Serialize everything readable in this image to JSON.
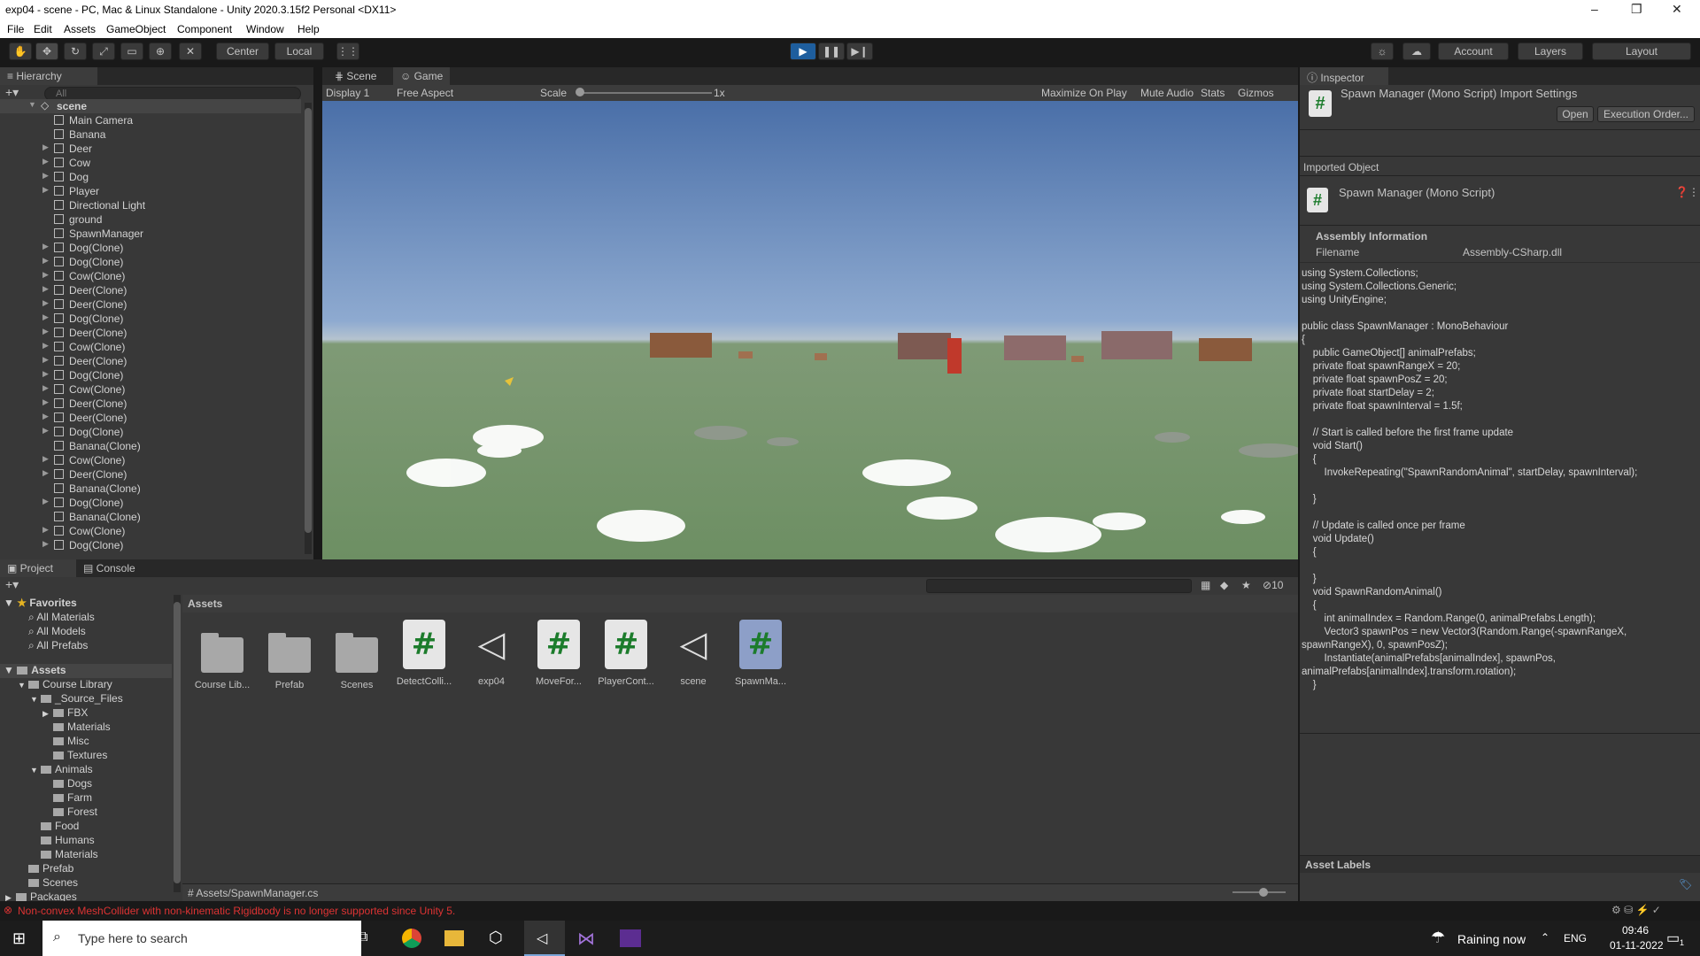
{
  "window": {
    "title": "exp04 - scene - PC, Mac & Linux Standalone - Unity 2020.3.15f2 Personal <DX11>",
    "minimize": "–",
    "maximize": "❐",
    "close": "✕"
  },
  "menu": [
    "File",
    "Edit",
    "Assets",
    "GameObject",
    "Component",
    "Window",
    "Help"
  ],
  "toolbar": {
    "center": "Center",
    "local": "Local",
    "account": "Account",
    "layers": "Layers",
    "layout": "Layout"
  },
  "hierarchy": {
    "tab": "Hierarchy",
    "search_placeholder": "All",
    "scene": "scene",
    "items": [
      {
        "label": "Main Camera",
        "arrow": ""
      },
      {
        "label": "Banana",
        "arrow": ""
      },
      {
        "label": "Deer",
        "arrow": "▶"
      },
      {
        "label": "Cow",
        "arrow": "▶"
      },
      {
        "label": "Dog",
        "arrow": "▶"
      },
      {
        "label": "Player",
        "arrow": "▶"
      },
      {
        "label": "Directional Light",
        "arrow": ""
      },
      {
        "label": "ground",
        "arrow": ""
      },
      {
        "label": "SpawnManager",
        "arrow": ""
      },
      {
        "label": "Dog(Clone)",
        "arrow": "▶"
      },
      {
        "label": "Dog(Clone)",
        "arrow": "▶"
      },
      {
        "label": "Cow(Clone)",
        "arrow": "▶"
      },
      {
        "label": "Deer(Clone)",
        "arrow": "▶"
      },
      {
        "label": "Deer(Clone)",
        "arrow": "▶"
      },
      {
        "label": "Dog(Clone)",
        "arrow": "▶"
      },
      {
        "label": "Deer(Clone)",
        "arrow": "▶"
      },
      {
        "label": "Cow(Clone)",
        "arrow": "▶"
      },
      {
        "label": "Deer(Clone)",
        "arrow": "▶"
      },
      {
        "label": "Dog(Clone)",
        "arrow": "▶"
      },
      {
        "label": "Cow(Clone)",
        "arrow": "▶"
      },
      {
        "label": "Deer(Clone)",
        "arrow": "▶"
      },
      {
        "label": "Deer(Clone)",
        "arrow": "▶"
      },
      {
        "label": "Dog(Clone)",
        "arrow": "▶"
      },
      {
        "label": "Banana(Clone)",
        "arrow": ""
      },
      {
        "label": "Cow(Clone)",
        "arrow": "▶"
      },
      {
        "label": "Deer(Clone)",
        "arrow": "▶"
      },
      {
        "label": "Banana(Clone)",
        "arrow": ""
      },
      {
        "label": "Dog(Clone)",
        "arrow": "▶"
      },
      {
        "label": "Banana(Clone)",
        "arrow": ""
      },
      {
        "label": "Cow(Clone)",
        "arrow": "▶"
      },
      {
        "label": "Dog(Clone)",
        "arrow": "▶"
      }
    ]
  },
  "game": {
    "tab_scene": "Scene",
    "tab_game": "Game",
    "display": "Display 1",
    "aspect": "Free Aspect",
    "scale_label": "Scale",
    "scale_value": "1x",
    "maximize": "Maximize On Play",
    "mute": "Mute Audio",
    "stats": "Stats",
    "gizmos": "Gizmos"
  },
  "inspector": {
    "tab": "Inspector",
    "header": "Spawn Manager (Mono Script) Import Settings",
    "open": "Open",
    "exec_order": "Execution Order...",
    "imported_object": "Imported Object",
    "object_name": "Spawn Manager (Mono Script)",
    "assembly_info": "Assembly Information",
    "filename_label": "Filename",
    "filename_value": "Assembly-CSharp.dll",
    "code": "using System.Collections;\nusing System.Collections.Generic;\nusing UnityEngine;\n\npublic class SpawnManager : MonoBehaviour\n{\n    public GameObject[] animalPrefabs;\n    private float spawnRangeX = 20;\n    private float spawnPosZ = 20;\n    private float startDelay = 2;\n    private float spawnInterval = 1.5f;\n\n    // Start is called before the first frame update\n    void Start()\n    {\n        InvokeRepeating(\"SpawnRandomAnimal\", startDelay, spawnInterval);\n\n    }\n\n    // Update is called once per frame\n    void Update()\n    {\n\n    }\n    void SpawnRandomAnimal()\n    {\n        int animalIndex = Random.Range(0, animalPrefabs.Length);\n        Vector3 spawnPos = new Vector3(Random.Range(-spawnRangeX,\nspawnRangeX), 0, spawnPosZ);\n        Instantiate(animalPrefabs[animalIndex], spawnPos,\nanimalPrefabs[animalIndex].transform.rotation);\n    }\n}",
    "asset_labels": "Asset Labels"
  },
  "project": {
    "tab_project": "Project",
    "tab_console": "Console",
    "hidden_count": "10",
    "favorites": "Favorites",
    "fav_items": [
      "All Materials",
      "All Models",
      "All Prefabs"
    ],
    "assets_root": "Assets",
    "tree": [
      {
        "label": "Course Library",
        "indent": 1,
        "arrow": "▼"
      },
      {
        "label": "_Source_Files",
        "indent": 2,
        "arrow": "▼"
      },
      {
        "label": "FBX",
        "indent": 3,
        "arrow": "▶"
      },
      {
        "label": "Materials",
        "indent": 3,
        "arrow": ""
      },
      {
        "label": "Misc",
        "indent": 3,
        "arrow": ""
      },
      {
        "label": "Textures",
        "indent": 3,
        "arrow": ""
      },
      {
        "label": "Animals",
        "indent": 2,
        "arrow": "▼"
      },
      {
        "label": "Dogs",
        "indent": 3,
        "arrow": ""
      },
      {
        "label": "Farm",
        "indent": 3,
        "arrow": ""
      },
      {
        "label": "Forest",
        "indent": 3,
        "arrow": ""
      },
      {
        "label": "Food",
        "indent": 2,
        "arrow": ""
      },
      {
        "label": "Humans",
        "indent": 2,
        "arrow": ""
      },
      {
        "label": "Materials",
        "indent": 2,
        "arrow": ""
      },
      {
        "label": "Prefab",
        "indent": 1,
        "arrow": ""
      },
      {
        "label": "Scenes",
        "indent": 1,
        "arrow": ""
      },
      {
        "label": "Packages",
        "indent": 0,
        "arrow": "▶"
      }
    ],
    "breadcrumb": "Assets",
    "assets": [
      {
        "label": "Course Lib...",
        "kind": "folder"
      },
      {
        "label": "Prefab",
        "kind": "folder"
      },
      {
        "label": "Scenes",
        "kind": "folder"
      },
      {
        "label": "DetectColli...",
        "kind": "script"
      },
      {
        "label": "exp04",
        "kind": "unity"
      },
      {
        "label": "MoveFor...",
        "kind": "script"
      },
      {
        "label": "PlayerCont...",
        "kind": "script"
      },
      {
        "label": "scene",
        "kind": "unity"
      },
      {
        "label": "SpawnMa...",
        "kind": "script"
      }
    ],
    "path": "Assets/SpawnManager.cs"
  },
  "status_error": "Non-convex MeshCollider with non-kinematic Rigidbody is no longer supported since Unity 5.",
  "taskbar": {
    "search_placeholder": "Type here to search",
    "weather": "Raining now",
    "lang": "ENG",
    "time": "09:46",
    "date": "01-11-2022",
    "notif_count": "1"
  }
}
